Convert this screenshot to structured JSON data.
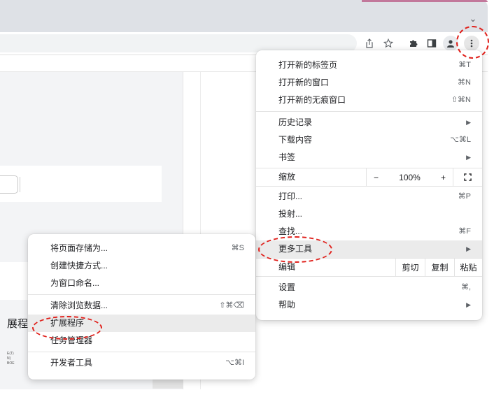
{
  "toolbar": {
    "icons": [
      "share-icon",
      "bookmark-star-icon",
      "extensions-puzzle-icon",
      "side-panel-icon",
      "profile-avatar-icon",
      "more-menu-icon"
    ]
  },
  "page": {
    "extension_text": "展程",
    "mini_text": [
      "E(T)",
      "N)",
      "BOE"
    ]
  },
  "main_menu": {
    "new_tab": {
      "label": "打开新的标签页",
      "shortcut": "⌘T"
    },
    "new_window": {
      "label": "打开新的窗口",
      "shortcut": "⌘N"
    },
    "new_incognito": {
      "label": "打开新的无痕窗口",
      "shortcut": "⇧⌘N"
    },
    "history": {
      "label": "历史记录"
    },
    "downloads": {
      "label": "下载内容",
      "shortcut": "⌥⌘L"
    },
    "bookmarks": {
      "label": "书签"
    },
    "zoom": {
      "label": "缩放",
      "minus": "−",
      "value": "100%",
      "plus": "+"
    },
    "print": {
      "label": "打印...",
      "shortcut": "⌘P"
    },
    "cast": {
      "label": "投射..."
    },
    "find": {
      "label": "查找...",
      "shortcut": "⌘F"
    },
    "more_tools": {
      "label": "更多工具"
    },
    "edit": {
      "label": "编辑",
      "cut": "剪切",
      "copy": "复制",
      "paste": "粘贴"
    },
    "settings": {
      "label": "设置",
      "shortcut": "⌘,"
    },
    "help": {
      "label": "帮助"
    }
  },
  "sub_menu": {
    "save_page": {
      "label": "将页面存储为...",
      "shortcut": "⌘S"
    },
    "create_shortcut": {
      "label": "创建快捷方式..."
    },
    "name_window": {
      "label": "为窗口命名..."
    },
    "clear_data": {
      "label": "清除浏览数据...",
      "shortcut": "⇧⌘⌫"
    },
    "extensions": {
      "label": "扩展程序"
    },
    "task_manager": {
      "label": "任务管理器"
    },
    "dev_tools": {
      "label": "开发者工具",
      "shortcut": "⌥⌘I"
    }
  },
  "colors": {
    "annotation": "#e0201b",
    "highlight": "#ebebeb"
  }
}
